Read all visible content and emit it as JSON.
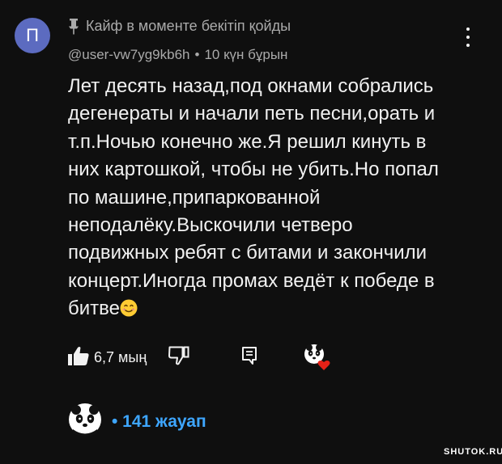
{
  "comment": {
    "avatar_letter": "П",
    "pinned_text": "Кайф в моменте бекітіп қойды",
    "username": "@user-vw7yg9kb6h",
    "separator": "•",
    "time_ago": "10 күн бұрын",
    "text": "Лет десять назад,под окнами собрались\nдегенераты и начали петь песни,орать и\nт.п.Ночью конечно же.Я решил кинуть в\nних картошкой, чтобы не убить.Но попал\nпо машине,припаркованной\nнеподалёку.Выскочили четверо\nподвижных ребят с битами и закончили\nконцерт.Иногда промах ведёт к победе в\nбитве",
    "emoji": "smiling-face-emoji"
  },
  "actions": {
    "like_count": "6,7 мың",
    "creator_heart": "creator-heart-badge"
  },
  "replies": {
    "label": "• 141 жауап"
  },
  "watermark": "SHUTOK.RU",
  "colors": {
    "background": "#0f0f0f",
    "text": "#f1f1f1",
    "secondary": "#aaaaaa",
    "link": "#3ea6ff",
    "avatar": "#5c6bc0",
    "heart": "#e62117"
  }
}
